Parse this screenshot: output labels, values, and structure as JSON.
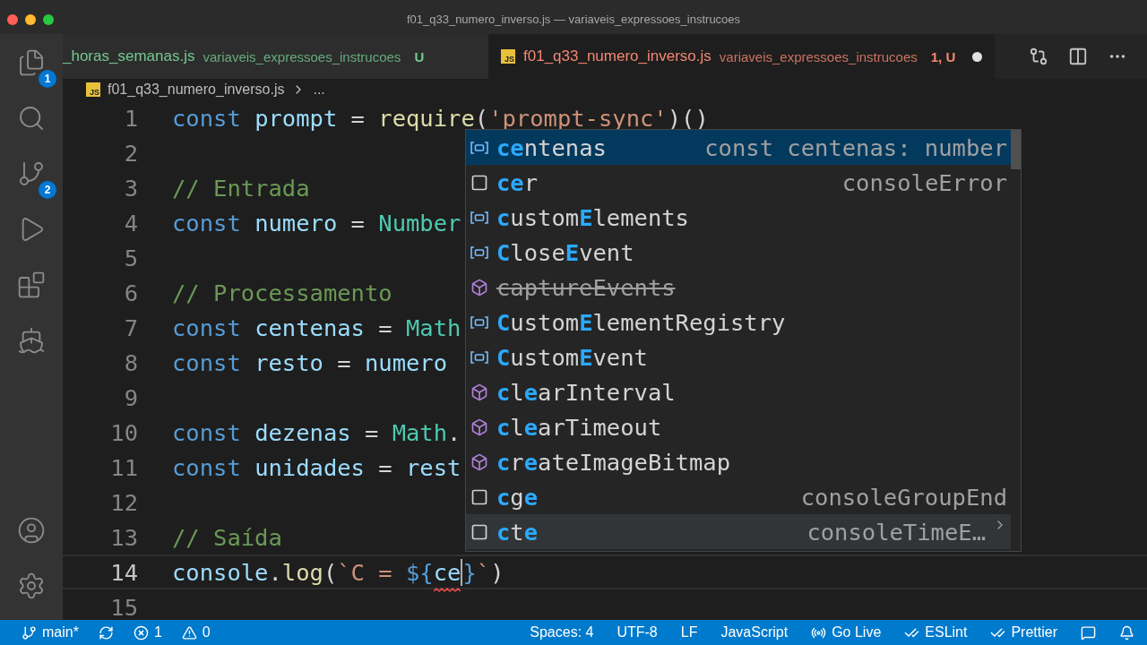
{
  "window": {
    "title": "f01_q33_numero_inverso.js — variaveis_expressoes_instrucoes"
  },
  "activity_bar": {
    "top": [
      {
        "kind": "files",
        "badge": "1"
      },
      {
        "kind": "search"
      },
      {
        "kind": "source_control",
        "badge": "2"
      },
      {
        "kind": "run"
      },
      {
        "kind": "extensions"
      },
      {
        "kind": "docker"
      }
    ],
    "bottom": [
      {
        "kind": "account"
      },
      {
        "kind": "settings"
      }
    ]
  },
  "tabs": [
    {
      "name": "_horas_semanas.js",
      "description": "variaveis_expressoes_instrucoes",
      "status": "U",
      "color": "#73c991",
      "selected": false,
      "dirty": false
    },
    {
      "icon_text": "JS",
      "name": "f01_q33_numero_inverso.js",
      "description": "variaveis_expressoes_instrucoes",
      "status": "1, U",
      "color": "#f48771",
      "selected": true,
      "dirty": true
    }
  ],
  "breadcrumb": {
    "icon_text": "JS",
    "file": "f01_q33_numero_inverso.js",
    "rest": "..."
  },
  "code": [
    {
      "number": "1",
      "current": false,
      "tokens": [
        {
          "kind": "keyword",
          "text": "const "
        },
        {
          "kind": "variable",
          "text": "prompt"
        },
        {
          "kind": "plain",
          "text": " = "
        },
        {
          "kind": "function",
          "text": "require"
        },
        {
          "kind": "plain",
          "text": "("
        },
        {
          "kind": "string",
          "text": "'prompt-sync'"
        },
        {
          "kind": "plain",
          "text": ")()"
        }
      ]
    },
    {
      "number": "2",
      "current": false
    },
    {
      "number": "3",
      "current": false,
      "tokens": [
        {
          "kind": "comment",
          "text": "// Entrada"
        }
      ]
    },
    {
      "number": "4",
      "current": false,
      "tokens": [
        {
          "kind": "keyword",
          "text": "const "
        },
        {
          "kind": "variable",
          "text": "numero"
        },
        {
          "kind": "plain",
          "text": " = "
        },
        {
          "kind": "class",
          "text": "Number"
        }
      ]
    },
    {
      "number": "5",
      "current": false
    },
    {
      "number": "6",
      "current": false,
      "tokens": [
        {
          "kind": "comment",
          "text": "// Processamento"
        }
      ]
    },
    {
      "number": "7",
      "current": false,
      "tokens": [
        {
          "kind": "keyword",
          "text": "const "
        },
        {
          "kind": "variable",
          "text": "centenas"
        },
        {
          "kind": "plain",
          "text": " = "
        },
        {
          "kind": "class",
          "text": "Math"
        }
      ]
    },
    {
      "number": "8",
      "current": false,
      "tokens": [
        {
          "kind": "keyword",
          "text": "const "
        },
        {
          "kind": "variable",
          "text": "resto"
        },
        {
          "kind": "plain",
          "text": " = "
        },
        {
          "kind": "variable",
          "text": "numero"
        }
      ]
    },
    {
      "number": "9",
      "current": false
    },
    {
      "number": "10",
      "current": false,
      "tokens": [
        {
          "kind": "keyword",
          "text": "const "
        },
        {
          "kind": "variable",
          "text": "dezenas"
        },
        {
          "kind": "plain",
          "text": " = "
        },
        {
          "kind": "class",
          "text": "Math"
        },
        {
          "kind": "plain",
          "text": "."
        }
      ]
    },
    {
      "number": "11",
      "current": false,
      "tokens": [
        {
          "kind": "keyword",
          "text": "const "
        },
        {
          "kind": "variable",
          "text": "unidades"
        },
        {
          "kind": "plain",
          "text": " = "
        },
        {
          "kind": "variable",
          "text": "rest"
        }
      ]
    },
    {
      "number": "12",
      "current": false
    },
    {
      "number": "13",
      "current": false,
      "tokens": [
        {
          "kind": "comment",
          "text": "// Saída"
        }
      ]
    },
    {
      "number": "14",
      "current": true,
      "tokens": [
        {
          "kind": "variable",
          "text": "console"
        },
        {
          "kind": "plain",
          "text": "."
        },
        {
          "kind": "function",
          "text": "log"
        },
        {
          "kind": "plain",
          "text": "("
        },
        {
          "kind": "string",
          "text": "`C = "
        },
        {
          "kind": "keyword",
          "text": "${"
        },
        {
          "kind": "variable",
          "text": "ce",
          "squiggle": true,
          "caret": true
        },
        {
          "kind": "keyword",
          "text": "}"
        },
        {
          "kind": "string",
          "text": "`"
        },
        {
          "kind": "plain",
          "text": ")"
        }
      ]
    },
    {
      "number": "15",
      "current": false
    }
  ],
  "suggestions": [
    {
      "kind": "variable",
      "selected": true,
      "deprecated": false,
      "label": "**ce**ntenas",
      "detail": "const centenas: number"
    },
    {
      "kind": "snippet",
      "selected": false,
      "deprecated": false,
      "label": "**ce**r",
      "detail": "consoleError"
    },
    {
      "kind": "variable",
      "selected": false,
      "deprecated": false,
      "label": "**c**ustom**E**lements"
    },
    {
      "kind": "variable",
      "selected": false,
      "deprecated": false,
      "label": "**C**lose**E**vent"
    },
    {
      "kind": "method",
      "selected": false,
      "deprecated": true,
      "label": "captureEvents"
    },
    {
      "kind": "variable",
      "selected": false,
      "deprecated": false,
      "label": "**C**ustom**E**lementRegistry"
    },
    {
      "kind": "variable",
      "selected": false,
      "deprecated": false,
      "label": "**C**ustom**E**vent"
    },
    {
      "kind": "method",
      "selected": false,
      "deprecated": false,
      "label": "**c**l**e**arInterval"
    },
    {
      "kind": "method",
      "selected": false,
      "deprecated": false,
      "label": "**c**l**e**arTimeout"
    },
    {
      "kind": "method",
      "selected": false,
      "deprecated": false,
      "label": "**c**r**e**ateImageBitmap"
    },
    {
      "kind": "snippet",
      "selected": false,
      "deprecated": false,
      "label": "**c**g**e**",
      "detail": "consoleGroupEnd"
    },
    {
      "kind": "snippet",
      "selected": false,
      "hovered": true,
      "deprecated": false,
      "more": true,
      "label": "**c**t**e**",
      "detail": "consoleTimeE…"
    }
  ],
  "status_bar": {
    "left": [
      {
        "kind": "branch",
        "text": "main*"
      },
      {
        "kind": "sync"
      },
      {
        "kind": "errors",
        "text": "1"
      },
      {
        "kind": "warnings",
        "text": "0"
      }
    ],
    "right": [
      {
        "kind": "text",
        "text": "Spaces: 4"
      },
      {
        "kind": "text",
        "text": "UTF-8"
      },
      {
        "kind": "text",
        "text": "LF"
      },
      {
        "kind": "text",
        "text": "JavaScript"
      },
      {
        "kind": "live",
        "text": "Go Live"
      },
      {
        "kind": "checks",
        "text": "ESLint"
      },
      {
        "kind": "checks",
        "text": "Prettier"
      },
      {
        "kind": "feedback"
      },
      {
        "kind": "bell"
      }
    ]
  }
}
